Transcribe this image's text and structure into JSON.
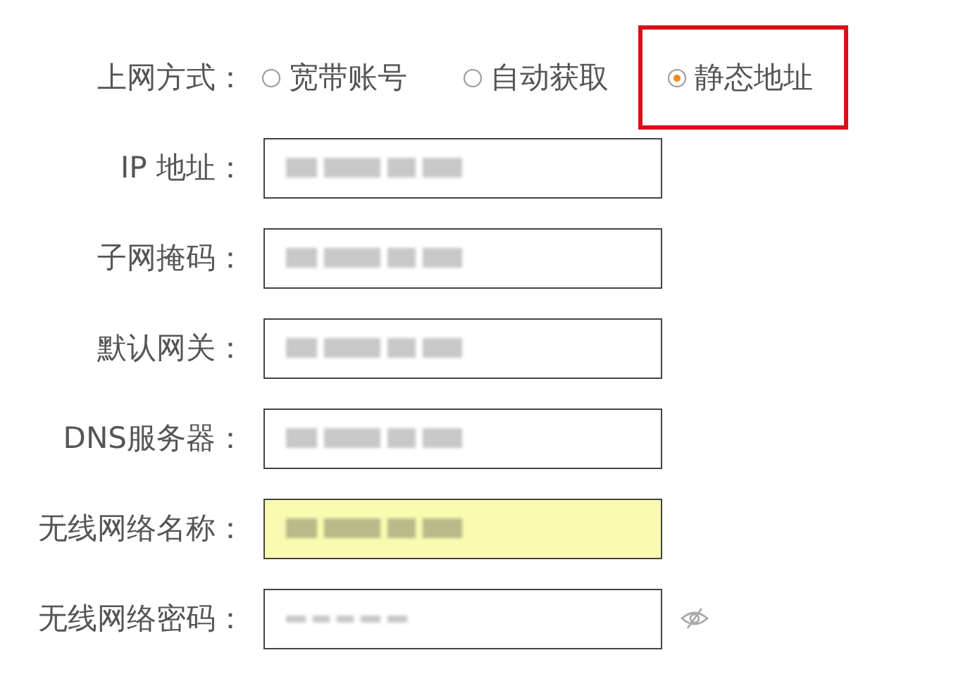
{
  "connection_type": {
    "label": "上网方式：",
    "options": [
      {
        "label": "宽带账号",
        "selected": false,
        "outlined": false
      },
      {
        "label": "自动获取",
        "selected": false,
        "outlined": false
      },
      {
        "label": "静态地址",
        "selected": true,
        "outlined": true
      }
    ]
  },
  "fields": [
    {
      "label": "IP 地址：",
      "kind": "text",
      "obscured": true,
      "highlighted": false
    },
    {
      "label": "子网掩码：",
      "kind": "text",
      "obscured": true,
      "highlighted": false
    },
    {
      "label": "默认网关：",
      "kind": "text",
      "obscured": true,
      "highlighted": false
    },
    {
      "label": "DNS服务器：",
      "kind": "text",
      "obscured": true,
      "highlighted": false
    },
    {
      "label": "无线网络名称：",
      "kind": "text",
      "obscured": true,
      "highlighted": true
    },
    {
      "label": "无线网络密码：",
      "kind": "password",
      "obscured": true,
      "highlighted": false
    }
  ]
}
